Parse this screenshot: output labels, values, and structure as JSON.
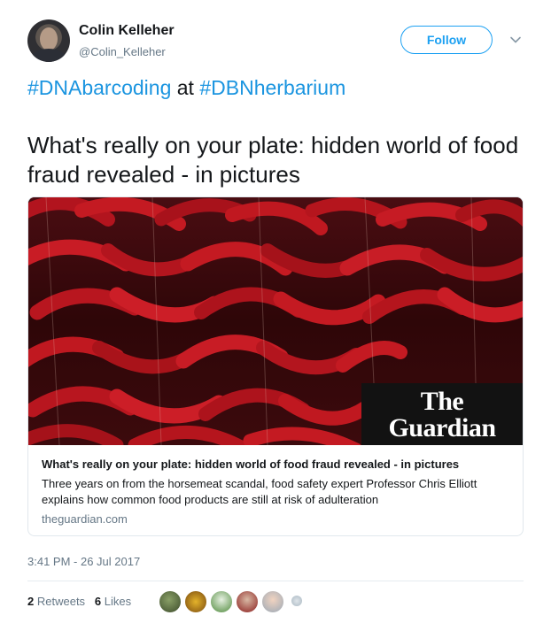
{
  "user": {
    "name": "Colin Kelleher",
    "handle": "@Colin_Kelleher"
  },
  "follow_label": "Follow",
  "hashtags": {
    "first": "#DNAbarcoding",
    "joiner": "at",
    "second": "#DBNherbarium"
  },
  "tweet_text": "What's really on your plate: hidden world of food fraud revealed - in pictures",
  "card": {
    "logo_line1": "The",
    "logo_line2": "Guardian",
    "title": "What's really on your plate: hidden world of food fraud revealed - in pictures",
    "description": "Three years on from the horsemeat scandal, food safety expert Professor Chris Elliott explains how common food products are still at risk of adulteration",
    "domain": "theguardian.com"
  },
  "timestamp": "3:41 PM - 26 Jul 2017",
  "stats": {
    "retweets_count": "2",
    "retweets_label": "Retweets",
    "likes_count": "6",
    "likes_label": "Likes"
  },
  "colors": {
    "accent": "#1da1f2",
    "hashtag": "#1b95e0",
    "muted": "#657786",
    "text": "#14171a"
  },
  "icons": [
    "chevron-down-icon"
  ]
}
